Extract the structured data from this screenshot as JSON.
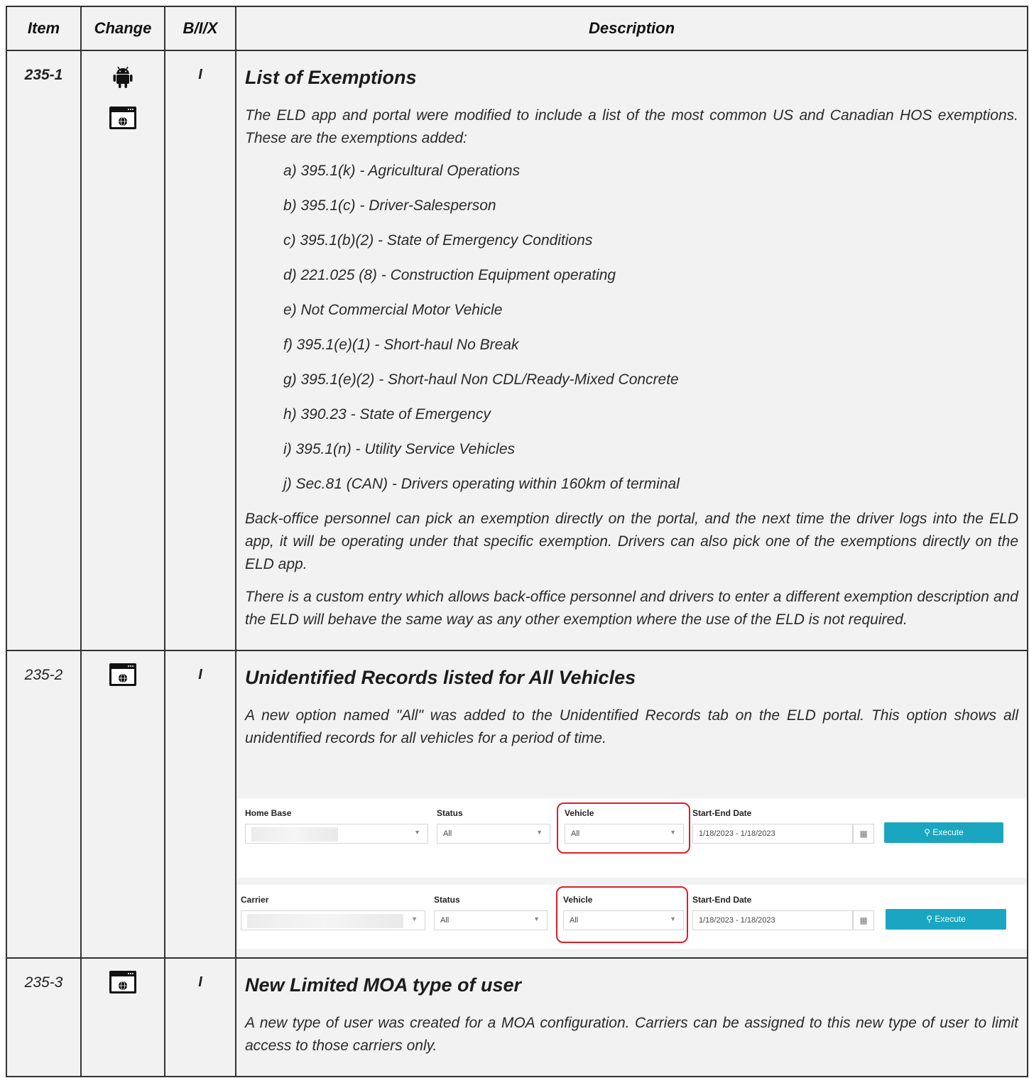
{
  "headers": {
    "item": "Item",
    "change": "Change",
    "bix": "B/I/X",
    "description": "Description"
  },
  "rows": [
    {
      "item": "235-1",
      "bix": "I",
      "title": "List of Exemptions",
      "intro": "The ELD app and portal were modified to include a list of the most common US and Canadian HOS exemptions. These are the exemptions added:",
      "list": [
        "a) 395.1(k) - Agricultural Operations",
        "b) 395.1(c) - Driver-Salesperson",
        "c) 395.1(b)(2) - State of Emergency Conditions",
        "d) 221.025 (8) - Construction Equipment operating",
        "e) Not Commercial Motor Vehicle",
        "f) 395.1(e)(1) - Short-haul No Break",
        "g) 395.1(e)(2) - Short-haul Non CDL/Ready-Mixed Concrete",
        "h) 390.23 - State of Emergency",
        "i) 395.1(n) - Utility Service Vehicles",
        "j) Sec.81 (CAN) - Drivers operating within 160km of terminal"
      ],
      "para2": "Back-office personnel can pick an exemption directly on the portal, and the next time the driver logs into the ELD app, it will be operating under that specific exemption. Drivers can also pick one of the exemptions directly on the ELD app.",
      "para3": "There is a custom entry which allows back-office personnel and drivers to enter a different exemption description and the ELD will behave the same way as any other exemption where the use of the ELD is not required."
    },
    {
      "item": "235-2",
      "bix": "I",
      "title": "Unidentified Records listed for All Vehicles",
      "intro": "A new option named \"All\" was added to the Unidentified Records tab on the ELD portal. This option shows all unidentified records for all vehicles for a period of time.",
      "screens": [
        {
          "first_label": "Home Base",
          "status_label": "Status",
          "status_value": "All",
          "vehicle_label": "Vehicle",
          "vehicle_value": "All",
          "date_label": "Start-End Date",
          "date_value": "1/18/2023 - 1/18/2023",
          "execute": "Execute"
        },
        {
          "first_label": "Carrier",
          "status_label": "Status",
          "status_value": "All",
          "vehicle_label": "Vehicle",
          "vehicle_value": "All",
          "date_label": "Start-End Date",
          "date_value": "1/18/2023 - 1/18/2023",
          "execute": "Execute"
        }
      ]
    },
    {
      "item": "235-3",
      "bix": "I",
      "title": "New Limited MOA type of user",
      "intro": "A new type of user was created for a MOA configuration. Carriers can be assigned to this new type of user to limit access to those carriers only."
    }
  ],
  "icons": {
    "android": "android-icon",
    "web": "web-portal-icon",
    "search": "search-icon",
    "calendar": "calendar-icon",
    "caret": "caret-down-icon"
  },
  "colors": {
    "execute": "#1aa6c0",
    "highlight": "#d9202b",
    "cell_bg": "#f2f2f2"
  }
}
